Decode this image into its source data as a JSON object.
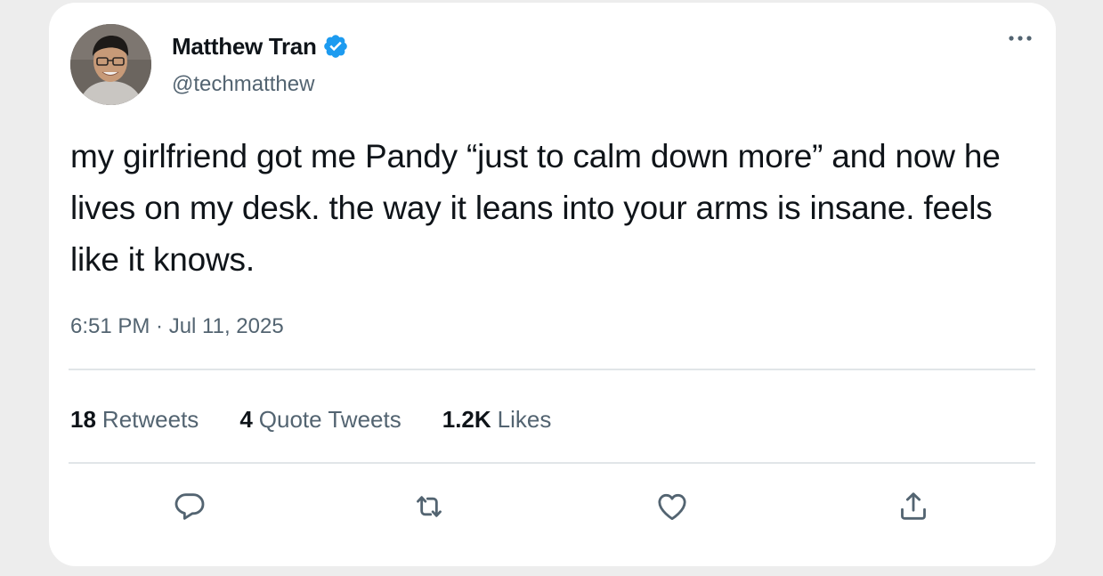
{
  "user": {
    "display_name": "Matthew Tran",
    "handle": "@techmatthew",
    "verified": true,
    "verified_color": "#1d9bf0",
    "avatar_icon": "profile-photo"
  },
  "tweet": {
    "text": "my girlfriend got me Pandy “just to calm down more” and now he lives on my desk. the way it leans into your arms is insane. feels like it knows.",
    "timestamp": "6:51 PM · Jul 11, 2025"
  },
  "stats": [
    {
      "count": "18",
      "label": "Retweets"
    },
    {
      "count": "4",
      "label": "Quote Tweets"
    },
    {
      "count": "1.2K",
      "label": "Likes"
    }
  ],
  "actions": {
    "reply_icon": "reply-icon",
    "retweet_icon": "retweet-icon",
    "like_icon": "heart-icon",
    "share_icon": "share-icon",
    "more_icon": "more-icon"
  },
  "colors": {
    "text_primary": "#0f1419",
    "text_secondary": "#536471",
    "icon": "#536471",
    "divider": "#e1e5e8",
    "background": "#ededed",
    "card": "#ffffff"
  }
}
